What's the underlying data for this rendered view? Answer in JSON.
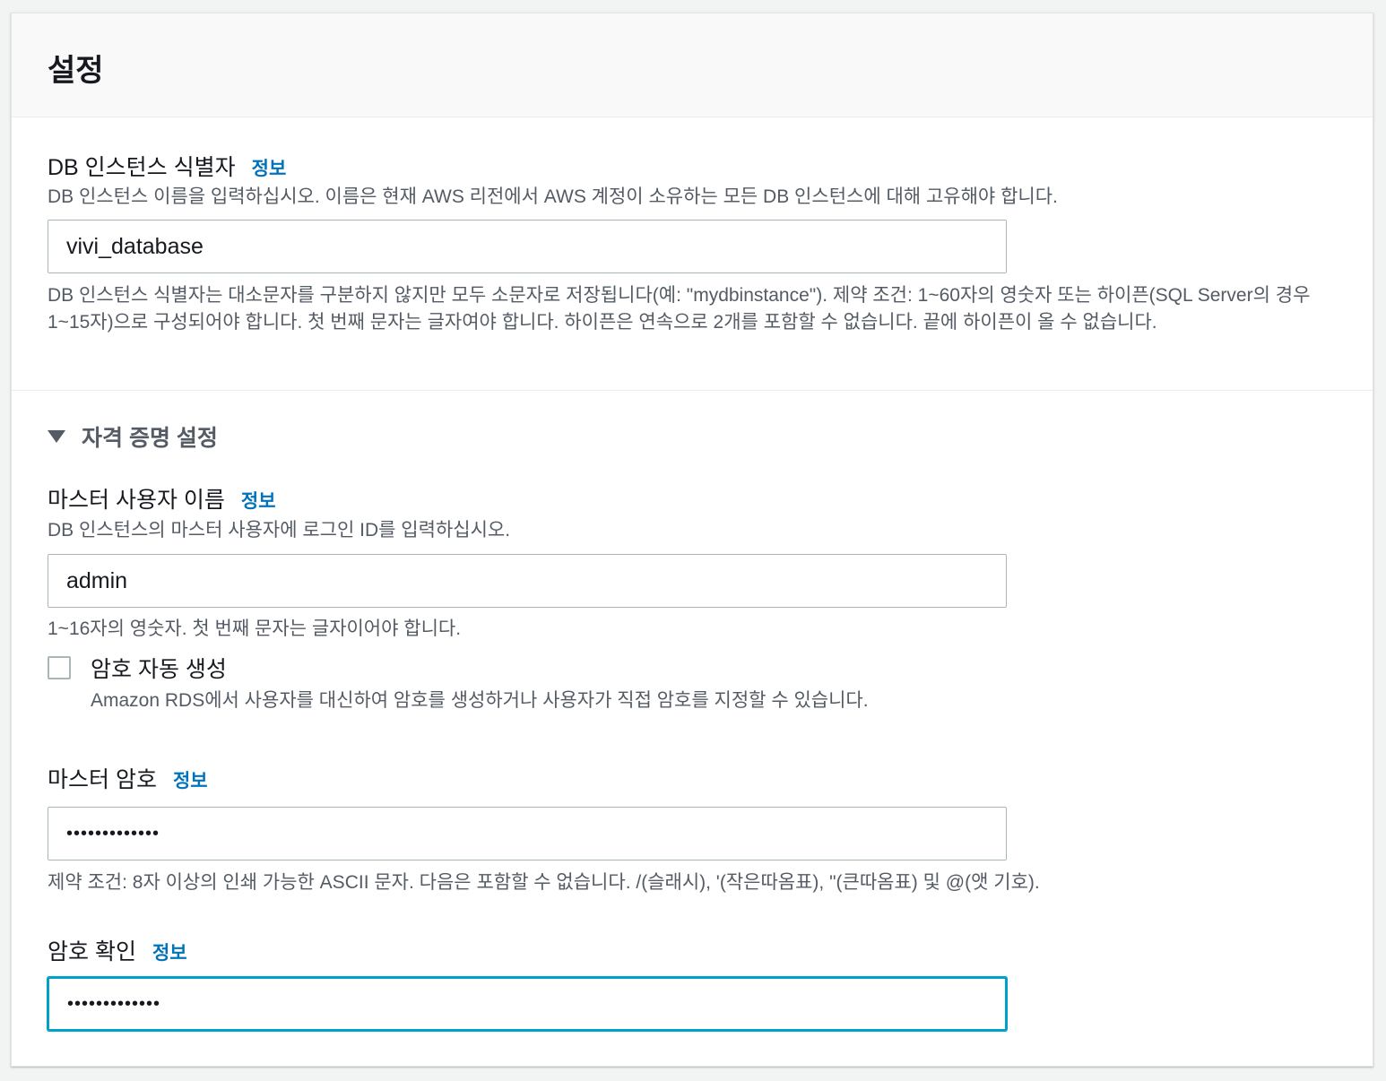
{
  "panel": {
    "title": "설정"
  },
  "db_identifier": {
    "label": "DB 인스턴스 식별자",
    "info": "정보",
    "description": "DB 인스턴스 이름을 입력하십시오. 이름은 현재 AWS 리전에서 AWS 계정이 소유하는 모든 DB 인스턴스에 대해 고유해야 합니다.",
    "value": "vivi_database",
    "constraint": "DB 인스턴스 식별자는 대소문자를 구분하지 않지만 모두 소문자로 저장됩니다(예: \"mydbinstance\"). 제약 조건: 1~60자의 영숫자 또는 하이픈(SQL Server의 경우 1~15자)으로 구성되어야 합니다. 첫 번째 문자는 글자여야 합니다. 하이픈은 연속으로 2개를 포함할 수 없습니다. 끝에 하이픈이 올 수 없습니다."
  },
  "credentials": {
    "expander_label": "자격 증명 설정",
    "expanded": true,
    "master_username": {
      "label": "마스터 사용자 이름",
      "info": "정보",
      "description": "DB 인스턴스의 마스터 사용자에 로그인 ID를 입력하십시오.",
      "value": "admin",
      "constraint": "1~16자의 영숫자. 첫 번째 문자는 글자이어야 합니다."
    },
    "auto_generate_password": {
      "label": "암호 자동 생성",
      "description": "Amazon RDS에서 사용자를 대신하여 암호를 생성하거나 사용자가 직접 암호를 지정할 수 있습니다.",
      "checked": false
    },
    "master_password": {
      "label": "마스터 암호",
      "info": "정보",
      "value": "•••••••••••••",
      "constraint": "제약 조건: 8자 이상의 인쇄 가능한 ASCII 문자. 다음은 포함할 수 없습니다. /(슬래시), '(작은따옴표), \"(큰따옴표) 및 @(앳 기호)."
    },
    "confirm_password": {
      "label": "암호 확인",
      "info": "정보",
      "value": "•••••••••••••"
    }
  },
  "colors": {
    "link": "#0073bb",
    "focus": "#00a1c9",
    "secondary_text": "#545b64"
  }
}
